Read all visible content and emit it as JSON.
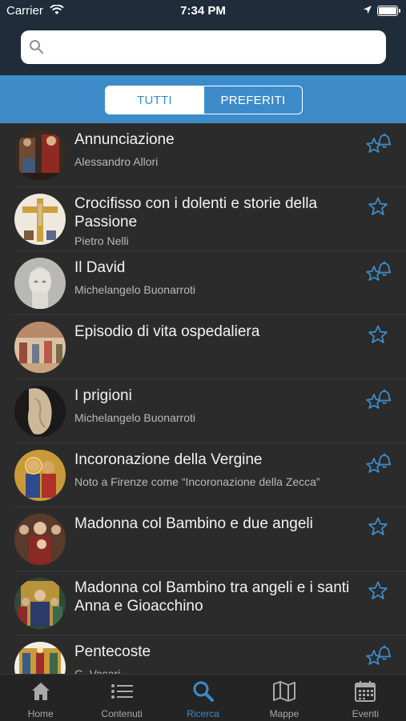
{
  "status": {
    "carrier": "Carrier",
    "time": "7:34 PM"
  },
  "search": {
    "placeholder": "",
    "value": ""
  },
  "segments": {
    "all": "TUTTI",
    "favorites": "PREFERITI"
  },
  "items": [
    {
      "title": "Annunciazione",
      "subtitle": "Alessandro Allori",
      "star": "star-bell-icon"
    },
    {
      "title": "Crocifisso con i dolenti e storie della Passione",
      "subtitle": "Pietro Nelli",
      "star": "star-icon"
    },
    {
      "title": "Il David",
      "subtitle": "Michelangelo Buonarroti",
      "star": "star-bell-icon"
    },
    {
      "title": "Episodio di vita ospedaliera",
      "subtitle": "",
      "star": "star-icon"
    },
    {
      "title": "I prigioni",
      "subtitle": "Michelangelo Buonarroti",
      "star": "star-bell-icon"
    },
    {
      "title": "Incoronazione della Vergine",
      "subtitle": "Noto a Firenze come “Incoronazione della Zecca”",
      "star": "star-bell-icon"
    },
    {
      "title": "Madonna col Bambino e due angeli",
      "subtitle": "",
      "star": "star-icon"
    },
    {
      "title": "Madonna col Bambino tra angeli e i santi Anna e Gioacchino",
      "subtitle": "",
      "star": "star-icon"
    },
    {
      "title": "Pentecoste",
      "subtitle": "G. Vasari",
      "star": "star-bell-icon"
    }
  ],
  "tabs": [
    {
      "label": "Home",
      "icon": "home-icon"
    },
    {
      "label": "Contenuti",
      "icon": "list-icon"
    },
    {
      "label": "Ricerca",
      "icon": "search-icon"
    },
    {
      "label": "Mappe",
      "icon": "map-icon"
    },
    {
      "label": "Eventi",
      "icon": "calendar-icon"
    }
  ],
  "colors": {
    "accent": "#3d8cc9",
    "background": "#2b2b2b",
    "header": "#1f2d3a"
  }
}
